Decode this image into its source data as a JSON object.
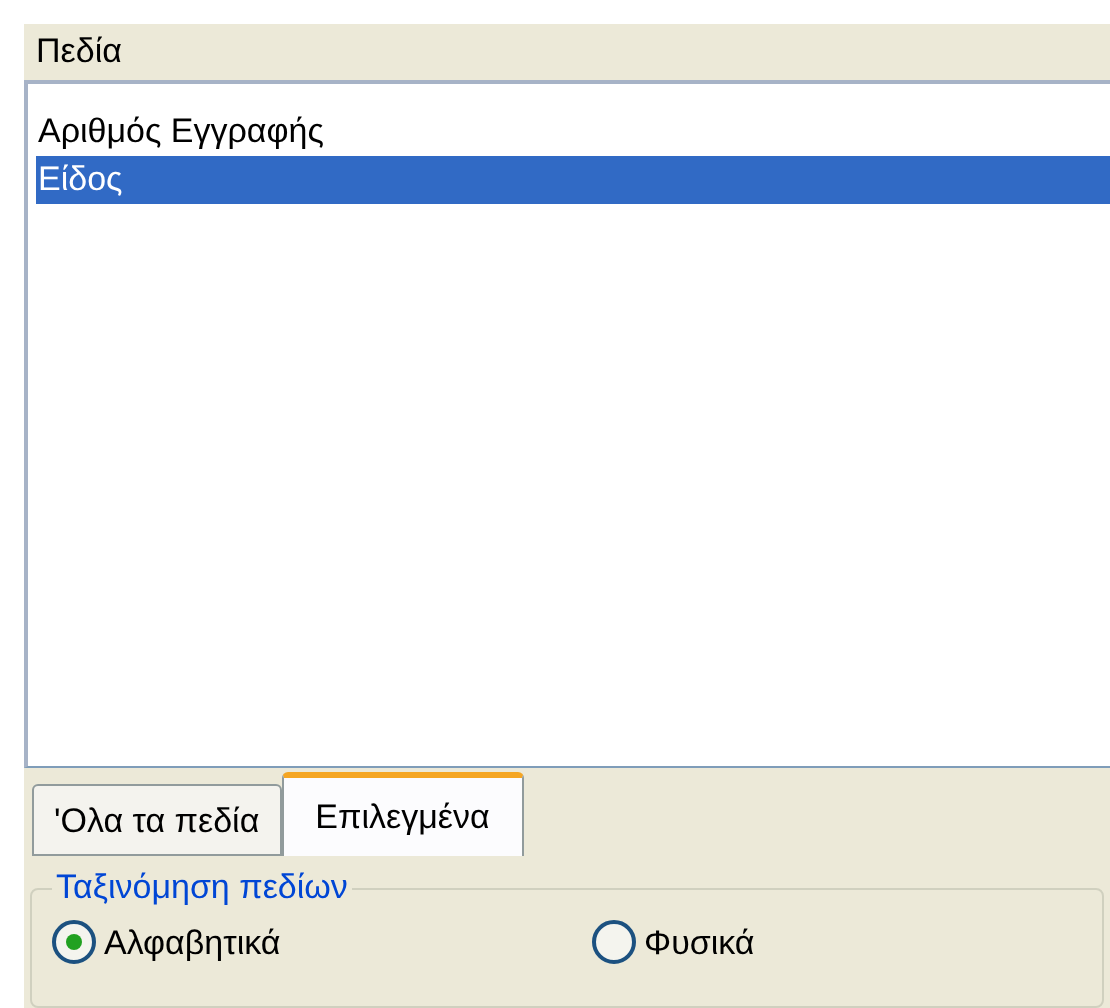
{
  "header": {
    "title": "Πεδία"
  },
  "list": {
    "items": [
      {
        "label": "Αριθμός Εγγραφής",
        "selected": false
      },
      {
        "label": "Είδος",
        "selected": true
      }
    ]
  },
  "tabs": [
    {
      "label": "'Ολα τα πεδία",
      "selected": false
    },
    {
      "label": "Επιλεγμένα",
      "selected": true
    }
  ],
  "sort_group": {
    "title": "Ταξινόμηση πεδίων",
    "options": [
      {
        "label": "Αλφαβητικά",
        "selected": true
      },
      {
        "label": "Φυσικά",
        "selected": false
      }
    ]
  }
}
